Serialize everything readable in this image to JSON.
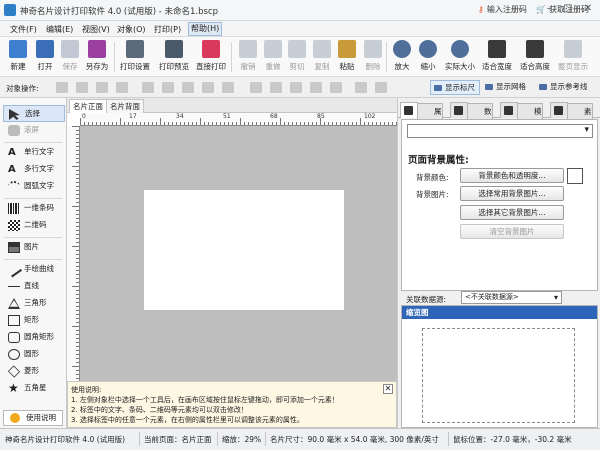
{
  "window": {
    "title": "神奇名片设计打印软件 4.0 (试用版) - 未命名1.bscp",
    "register_label": "输入注册码",
    "getcode_label": "获取注册码"
  },
  "menu": [
    "文件(F)",
    "编辑(E)",
    "视图(V)",
    "对象(O)",
    "打印(P)",
    "帮助(H)"
  ],
  "toolbar": [
    "新建",
    "打开",
    "保存",
    "另存为",
    "打印设置",
    "打印预览",
    "直接打印",
    "撤销",
    "重做",
    "剪切",
    "复制",
    "粘贴",
    "删除",
    "放大",
    "缩小",
    "实际大小",
    "适合宽度",
    "适合高度",
    "整页显示"
  ],
  "objbar": {
    "label": "对象操作:",
    "show_ruler": "显示标尺",
    "show_grid": "显示网格",
    "show_guides": "显示参考线"
  },
  "tools": [
    "选择",
    "滚屏",
    "单行文字",
    "多行文字",
    "圆弧文字",
    "一维条码",
    "二维码",
    "图片",
    "手绘曲线",
    "直线",
    "三角形",
    "矩形",
    "圆角矩形",
    "圆形",
    "菱形",
    "五角星"
  ],
  "help_button": "使用说明",
  "canvas": {
    "tabs": [
      "名片正面",
      "名片背面"
    ],
    "ruler_marks": [
      "0",
      "17",
      "34",
      "51",
      "68",
      "85",
      "102"
    ]
  },
  "help_text": {
    "heading": "使用说明:",
    "lines": [
      "1. 左侧对象栏中选择一个工具后，在画布区域按住鼠标左键拖动，即可添加一个元素！",
      "2. 标签中的文字、条码、二维码等元素均可以双击修改！",
      "3. 选择标签中的任意一个元素，在右侧的属性栏里可以调整该元素的属性。"
    ],
    "close": "✕"
  },
  "rightpanel": {
    "tabs": [
      "属性栏",
      "数据库",
      "模板库",
      "素材库"
    ],
    "heading": "页面背景属性:",
    "bg_color_label": "背景颜色:",
    "bg_image_label": "背景图片:",
    "buttons": [
      "背景颜色和透明度...",
      "选择常用背景图片...",
      "选择其它背景图片...",
      "清空背景图片"
    ],
    "assoc_label": "关联数据源:",
    "assoc_value": "<不关联数据源>",
    "preview_label": "缩览图"
  },
  "status": {
    "app": "神奇名片设计打印软件 4.0 (试用版)",
    "page": "当前页面：名片正面",
    "zoom": "缩放：29%",
    "size": "名片尺寸：90.0 毫米 x 54.0 毫米, 300 像素/英寸",
    "pos": "鼠标位置：-27.0 毫米，-30.2 毫米"
  },
  "colors": {
    "accent": "#2f65b8",
    "canvas_bg": "#bebebe",
    "help_bg": "#fdf7e3"
  }
}
